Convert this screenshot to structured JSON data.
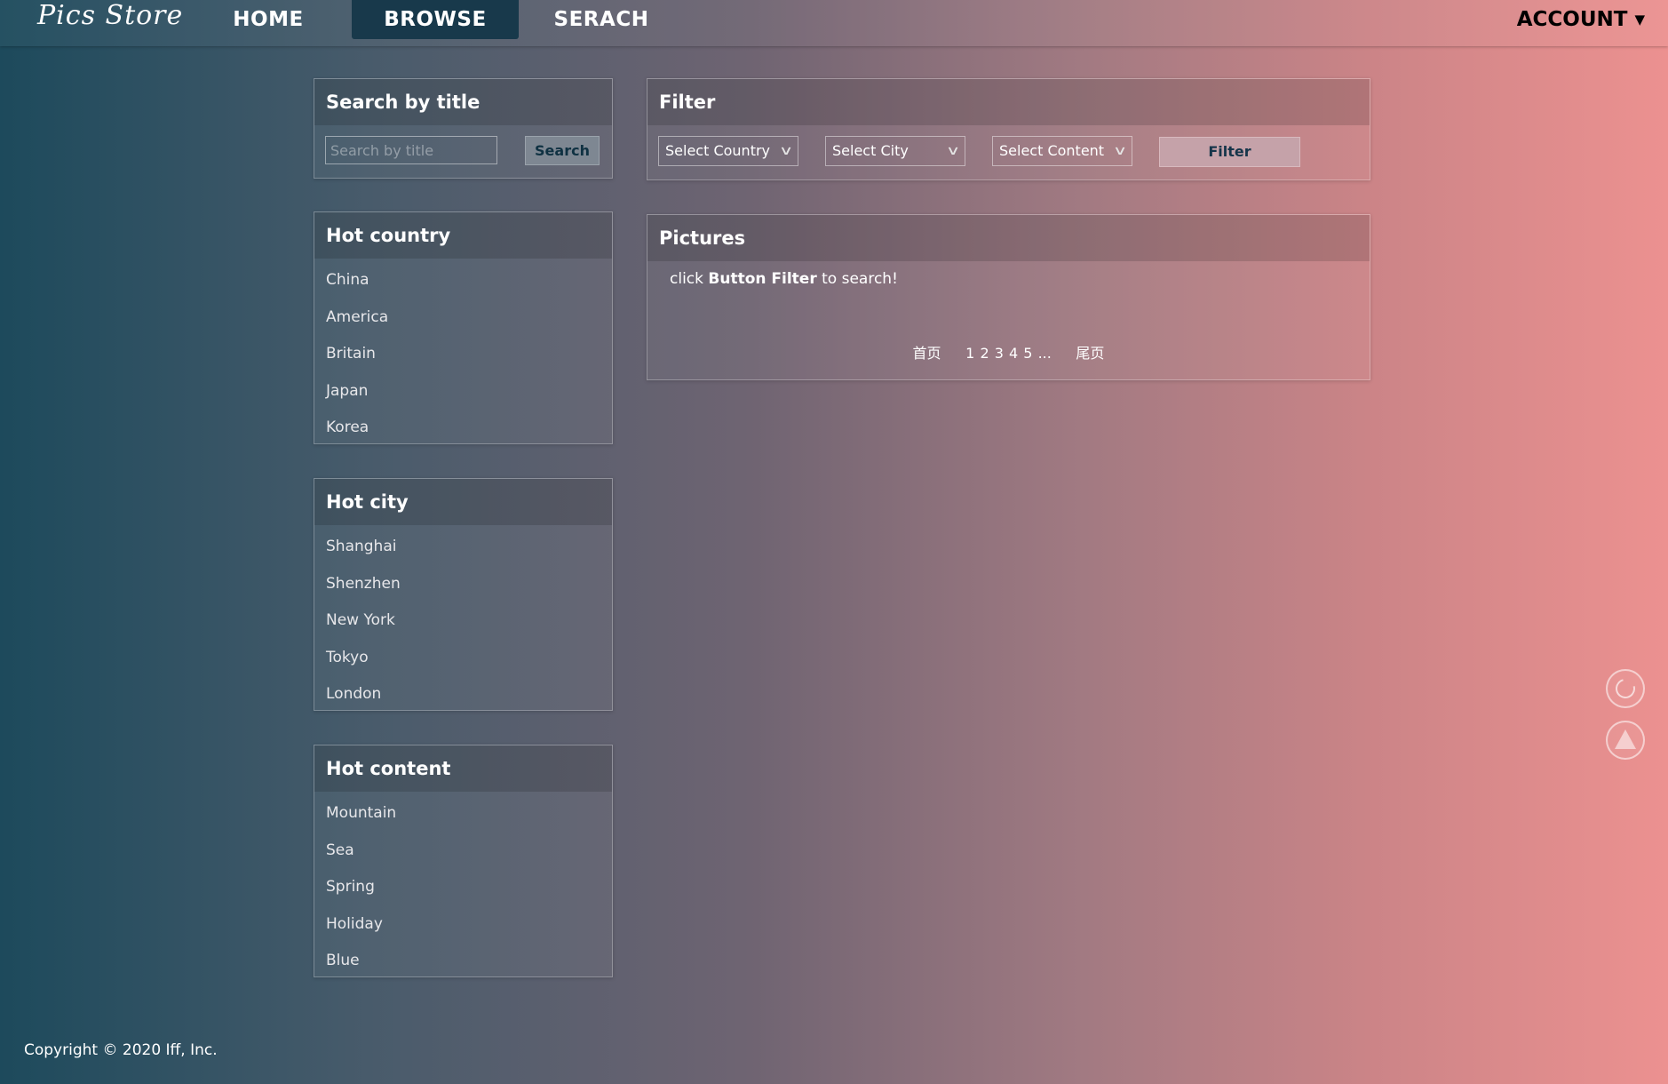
{
  "nav": {
    "logo": "Pics Store",
    "items": [
      "HOME",
      "BROWSE",
      "SERACH"
    ],
    "account": "ACCOUNT"
  },
  "search_panel": {
    "title": "Search by title",
    "placeholder": "Search by title",
    "button": "Search"
  },
  "hot_country": {
    "title": "Hot country",
    "items": [
      "China",
      "America",
      "Britain",
      "Japan",
      "Korea"
    ]
  },
  "hot_city": {
    "title": "Hot city",
    "items": [
      "Shanghai",
      "Shenzhen",
      "New York",
      "Tokyo",
      "London"
    ]
  },
  "hot_content": {
    "title": "Hot content",
    "items": [
      "Mountain",
      "Sea",
      "Spring",
      "Holiday",
      "Blue"
    ]
  },
  "filter_panel": {
    "title": "Filter",
    "selects": [
      "Select Country",
      "Select City",
      "Select Content"
    ],
    "button": "Filter"
  },
  "pictures_panel": {
    "title": "Pictures",
    "msg_prefix": "click ",
    "msg_bold": "Button Filter",
    "msg_suffix": " to search!",
    "pager": {
      "first": "首页",
      "pages": [
        "1",
        "2",
        "3",
        "4",
        "5"
      ],
      "ellipsis": "...",
      "last": "尾页"
    }
  },
  "footer": {
    "copyright": "Copyright © 2020 Iff, Inc."
  },
  "floating": {
    "refresh_icon": "refresh-icon",
    "top_icon": "back-to-top-icon"
  }
}
